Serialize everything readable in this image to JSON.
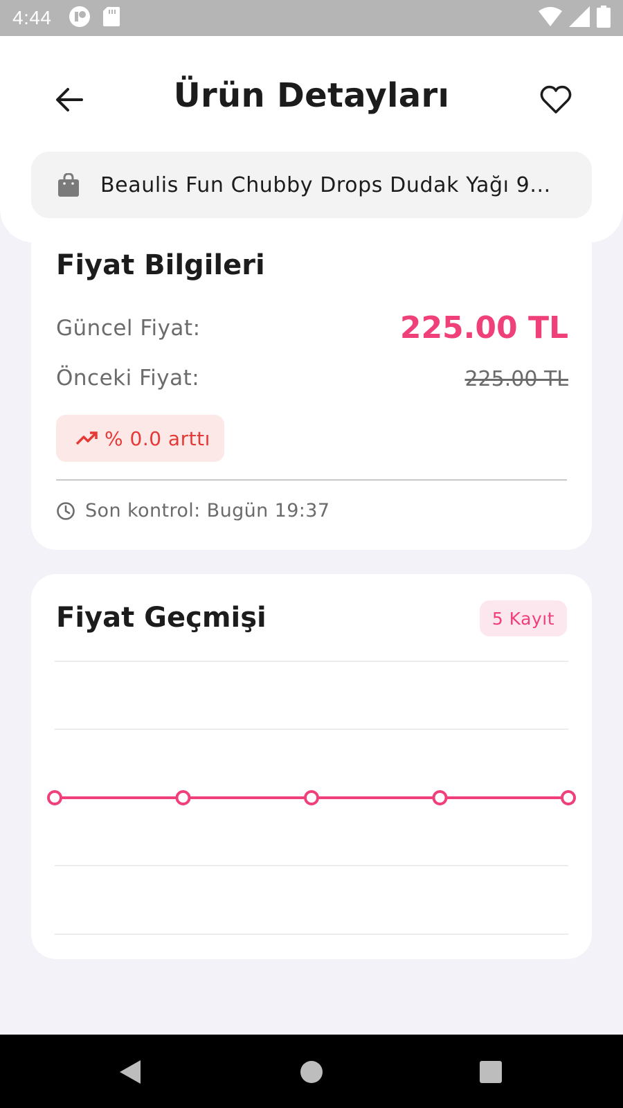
{
  "status_bar": {
    "time": "4:44"
  },
  "header": {
    "title": "Ürün Detayları",
    "back_icon": "arrow-left-icon",
    "favorite_icon": "heart-outline-icon"
  },
  "product": {
    "name": "Beaulis Fun Chubby Drops Dudak Yağı 9...",
    "icon": "shopping-bag-icon"
  },
  "price_info": {
    "title": "Fiyat Bilgileri",
    "current_label": "Güncel Fiyat:",
    "current_price": "225.00 TL",
    "previous_label": "Önceki Fiyat:",
    "previous_price": "225.00 TL",
    "change_text": "% 0.0 arttı",
    "change_icon": "trending-up-icon",
    "last_check": "Son kontrol: Bugün 19:37",
    "clock_icon": "clock-icon"
  },
  "history": {
    "title": "Fiyat Geçmişi",
    "records_badge": "5 Kayıt"
  },
  "colors": {
    "accent": "#f0407a",
    "increase": "#e53935"
  },
  "chart_data": {
    "type": "line",
    "x": [
      1,
      2,
      3,
      4,
      5
    ],
    "series": [
      {
        "values": [
          225.0,
          225.0,
          225.0,
          225.0,
          225.0
        ]
      }
    ],
    "grid": true
  }
}
